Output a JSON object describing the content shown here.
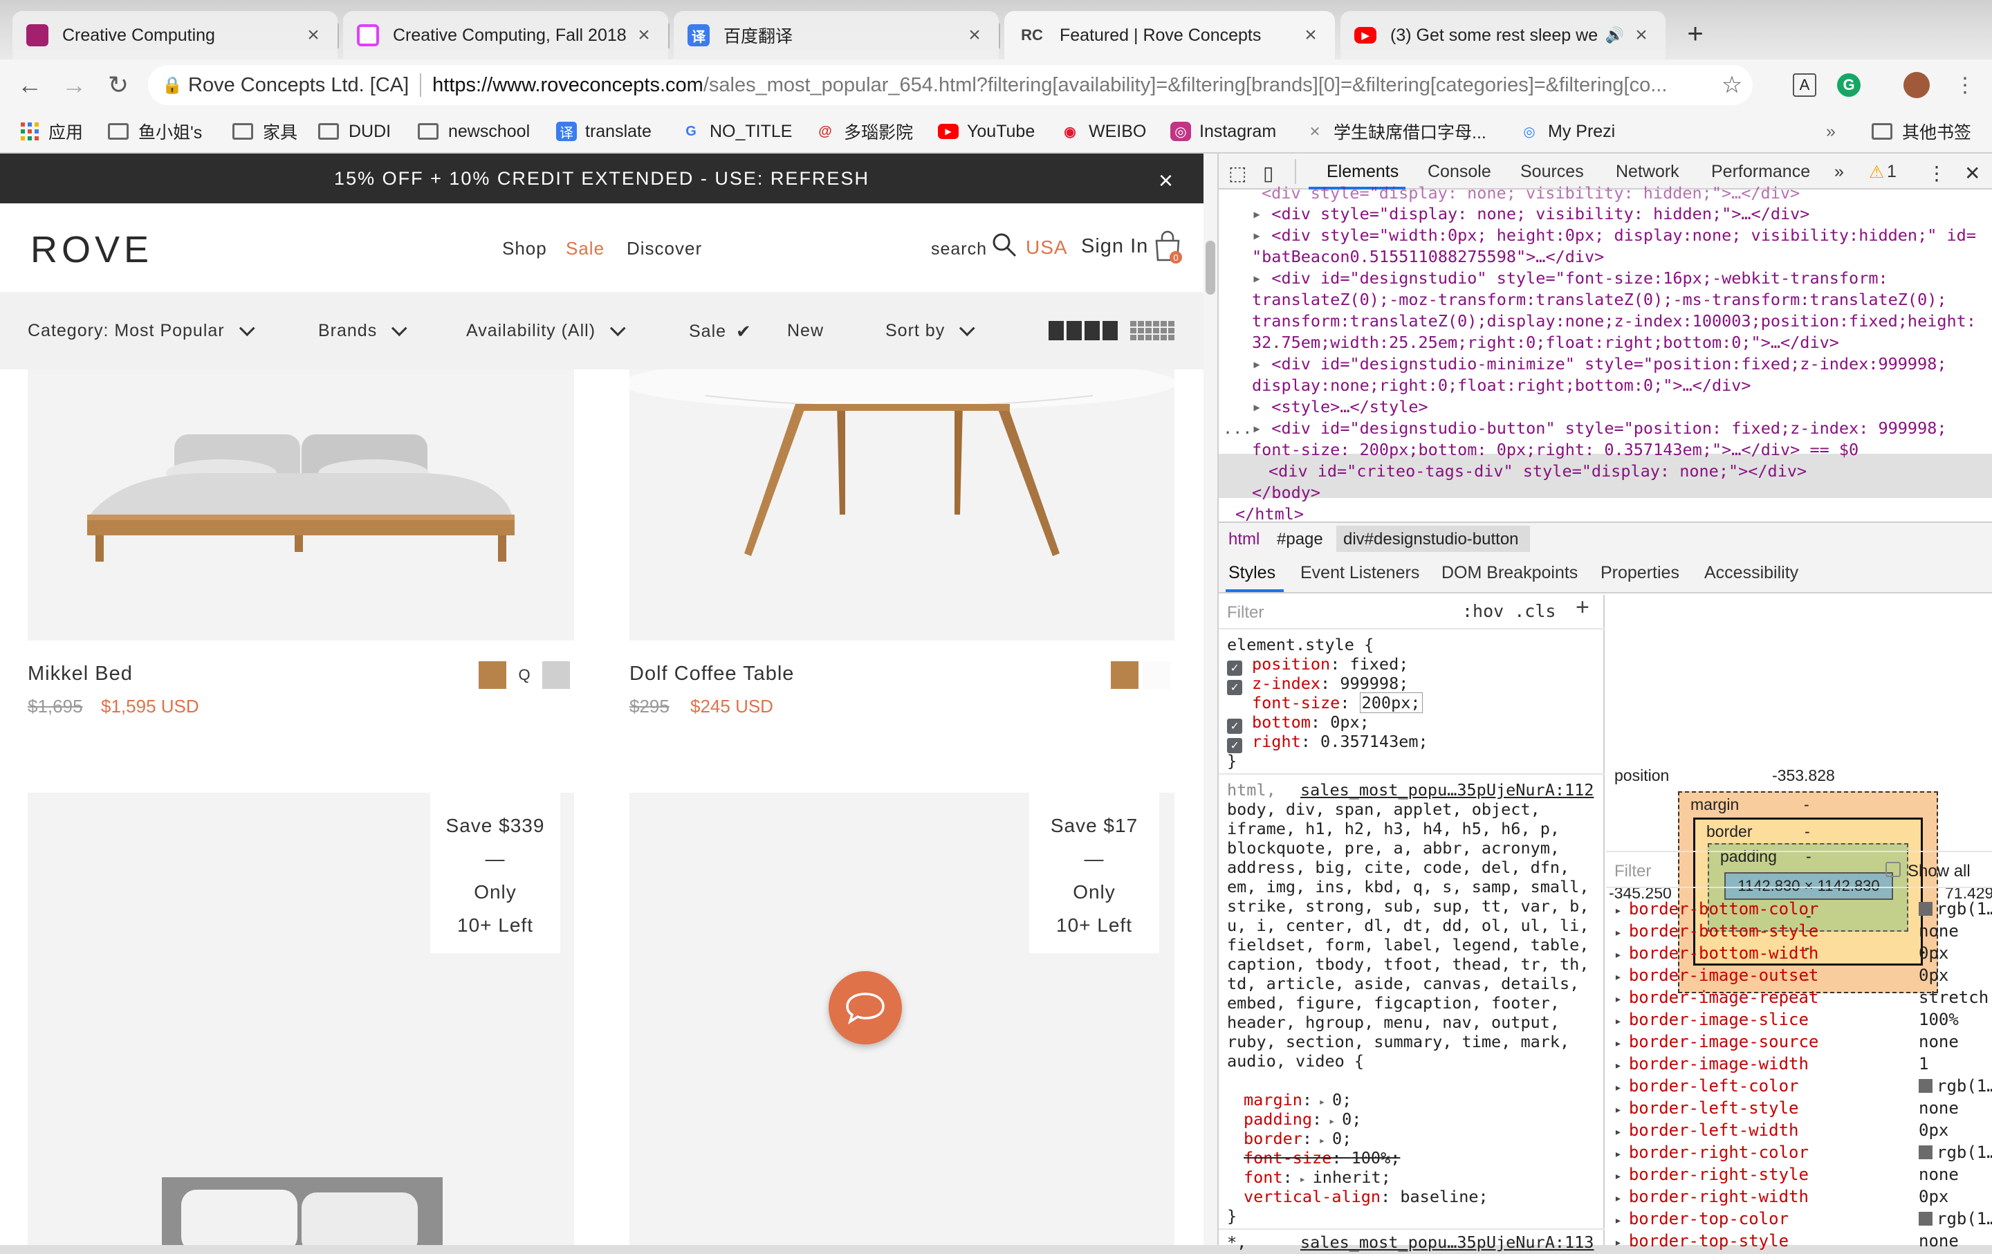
{
  "browser": {
    "tabs": [
      {
        "title": "Creative Computing",
        "icon": "creative-computing-favicon",
        "color": "#a3206e"
      },
      {
        "title": "Creative Computing, Fall 2018",
        "icon": "cc-favicon",
        "color": "#e040fb"
      },
      {
        "title": "百度翻译",
        "icon": "baidu-translate-favicon",
        "color": "#3a7bef"
      },
      {
        "title": "Featured | Rove Concepts",
        "icon": "rc-favicon",
        "color": "#444444"
      },
      {
        "title": "(3) Get some rest sleep we",
        "icon": "youtube-favicon",
        "color": "#ff0000"
      }
    ],
    "favicon_labels": {
      "tab3": "译",
      "tab4": "RC"
    },
    "new_tab_label": "+",
    "omnibox": {
      "site_name": "Rove Concepts Ltd. [CA]",
      "url_domain": "https://www.roveconcepts.com",
      "url_path": "/sales_most_popular_654.html?filtering[availability]=&filtering[brands][0]=&filtering[categories]=&filtering[co..."
    },
    "bookmarks": [
      {
        "label": "应用",
        "icon": "apps-grid-icon"
      },
      {
        "label": "鱼小姐's",
        "icon": "folder-icon"
      },
      {
        "label": "家具",
        "icon": "folder-icon"
      },
      {
        "label": "DUDI",
        "icon": "folder-icon"
      },
      {
        "label": "newschool",
        "icon": "folder-icon"
      },
      {
        "label": "translate",
        "icon": "translate-icon"
      },
      {
        "label": "NO_TITLE",
        "icon": "google-translate-icon"
      },
      {
        "label": "多瑙影院",
        "icon": "cinema-icon"
      },
      {
        "label": "YouTube",
        "icon": "youtube-icon"
      },
      {
        "label": "WEIBO",
        "icon": "weibo-icon"
      },
      {
        "label": "Instagram",
        "icon": "instagram-icon"
      },
      {
        "label": "学生缺席借口字母...",
        "icon": "bookmark-icon"
      },
      {
        "label": "My Prezi",
        "icon": "prezi-icon"
      }
    ],
    "bookmarks_overflow": "»",
    "other_bookmarks": "其他书签"
  },
  "site": {
    "promo_text": "15% OFF + 10% CREDIT EXTENDED - USE: REFRESH",
    "logo": "ROVE",
    "nav": [
      "Shop",
      "Sale",
      "Discover"
    ],
    "search_label": "search",
    "region": "USA",
    "sign_in": "Sign In",
    "cart_count": "0",
    "filters": {
      "category": "Category: Most Popular",
      "brands": "Brands",
      "availability": "Availability (All)",
      "sale": "Sale",
      "new": "New",
      "sort": "Sort by"
    },
    "products": [
      {
        "name": "Mikkel Bed",
        "old_price": "$1,695",
        "price": "$1,595 USD",
        "swatch_q": "Q"
      },
      {
        "name": "Dolf Coffee Table",
        "old_price": "$295",
        "price": "$245 USD"
      }
    ],
    "badges": [
      {
        "line1": "Save $339",
        "line2": "—",
        "line3": "Only",
        "line4": "10+ Left"
      },
      {
        "line1": "Save $17",
        "line2": "—",
        "line3": "Only",
        "line4": "10+ Left"
      }
    ],
    "colors": {
      "accent": "#e0724a",
      "promo_bg": "#2d2d2d",
      "wood": "#b8834a"
    }
  },
  "devtools": {
    "tabs": [
      "Elements",
      "Console",
      "Sources",
      "Network",
      "Performance",
      "»"
    ],
    "warning_count": "1",
    "dom_lines": {
      "l0": "<div style=\"display: none; visibility: hidden;\">…</div>",
      "l1_open": "<div style=\"display: none; visibility: hidden;\">…</div>",
      "l2a": "<div style=\"width:0px; height:0px; display:none; visibility:hidden;\" id=",
      "l2b": "\"batBeacon0.515511088275598\">…</div>",
      "l3a": "<div id=\"designstudio\" style=\"font-size:16px;-webkit-transform:",
      "l3b": "translateZ(0);-moz-transform:translateZ(0);-ms-transform:translateZ(0);",
      "l3c": "transform:translateZ(0);display:none;z-index:100003;position:fixed;height:",
      "l3d": "32.75em;width:25.25em;right:0;float:right;bottom:0;\">…</div>",
      "l4a": "<div id=\"designstudio-minimize\" style=\"position:fixed;z-index:999998;",
      "l4b": "display:none;right:0;float:right;bottom:0;\">…</div>",
      "l5": "<style>…</style>",
      "l6a": "<div id=\"designstudio-button\" style=\"position: fixed;z-index: 999998;",
      "l6b": "font-size: 200px;bottom: 0px;right: 0.357143em;\">…</div> == $0",
      "l7": "<div id=\"criteo-tags-div\" style=\"display: none;\"></div>",
      "l8": "</body>",
      "l9": "</html>",
      "ellipsis": "..."
    },
    "breadcrumbs": [
      "html",
      "#page",
      "div#designstudio-button"
    ],
    "subtabs": [
      "Styles",
      "Event Listeners",
      "DOM Breakpoints",
      "Properties",
      "Accessibility"
    ],
    "filter_placeholder": "Filter",
    "hov_cls": ":hov  .cls",
    "element_style": {
      "selector": "element.style {",
      "rules": [
        {
          "prop": "position",
          "val": "fixed;"
        },
        {
          "prop": "z-index",
          "val": "999998;"
        },
        {
          "prop": "font-size",
          "val": "200px;"
        },
        {
          "prop": "bottom",
          "val": "0px;"
        },
        {
          "prop": "right",
          "val": "0.357143em;"
        }
      ],
      "close": "}"
    },
    "reset_rule": {
      "source1": "sales_most_popu…35pUjeNurA:112",
      "source2": "sales_most_popu…35pUjeNurA:113",
      "selector_lines": [
        "html,",
        "body, div, span, applet, object,",
        "iframe, h1, h2, h3, h4, h5, h6, p,",
        "blockquote, pre, a, abbr, acronym,",
        "address, big, cite, code, del, dfn,",
        "em, img, ins, kbd, q, s, samp, small,",
        "strike, strong, sub, sup, tt, var, b,",
        "u, i, center, dl, dt, dd, ol, ul, li,",
        "fieldset, form, label, legend, table,",
        "caption, tbody, tfoot, thead, tr, th,",
        "td, article, aside, canvas, details,",
        "embed, figure, figcaption, footer,",
        "header, hgroup, menu, nav, output,",
        "ruby, section, summary, time, mark,",
        "audio, video {"
      ],
      "decls": [
        {
          "prop": "margin",
          "val": "0;"
        },
        {
          "prop": "padding",
          "val": "0;"
        },
        {
          "prop": "border",
          "val": "0;"
        },
        {
          "prop": "font-size",
          "val": "100%;"
        },
        {
          "prop": "font",
          "val": "inherit;"
        },
        {
          "prop": "vertical-align",
          "val": "baseline;"
        }
      ],
      "next_selector": "*,"
    },
    "box_model": {
      "position_label": "position",
      "position_top": "-353.828",
      "left": "-345.250",
      "right": "71.429",
      "margin_label": "margin",
      "border_label": "border",
      "padding_label": "padding",
      "content": "1142.830 × 1142.830",
      "dash": "-",
      "zero": "0"
    },
    "computed_filter": "Filter",
    "show_all": "Show all",
    "computed": [
      {
        "prop": "border-bottom-color",
        "val": "rgb(1…",
        "swatch": true
      },
      {
        "prop": "border-bottom-style",
        "val": "none"
      },
      {
        "prop": "border-bottom-width",
        "val": "0px"
      },
      {
        "prop": "border-image-outset",
        "val": "0px"
      },
      {
        "prop": "border-image-repeat",
        "val": "stretch"
      },
      {
        "prop": "border-image-slice",
        "val": "100%"
      },
      {
        "prop": "border-image-source",
        "val": "none"
      },
      {
        "prop": "border-image-width",
        "val": "1"
      },
      {
        "prop": "border-left-color",
        "val": "rgb(1…",
        "swatch": true
      },
      {
        "prop": "border-left-style",
        "val": "none"
      },
      {
        "prop": "border-left-width",
        "val": "0px"
      },
      {
        "prop": "border-right-color",
        "val": "rgb(1…",
        "swatch": true
      },
      {
        "prop": "border-right-style",
        "val": "none"
      },
      {
        "prop": "border-right-width",
        "val": "0px"
      },
      {
        "prop": "border-top-color",
        "val": "rgb(1…",
        "swatch": true
      },
      {
        "prop": "border-top-style",
        "val": "none"
      }
    ]
  }
}
